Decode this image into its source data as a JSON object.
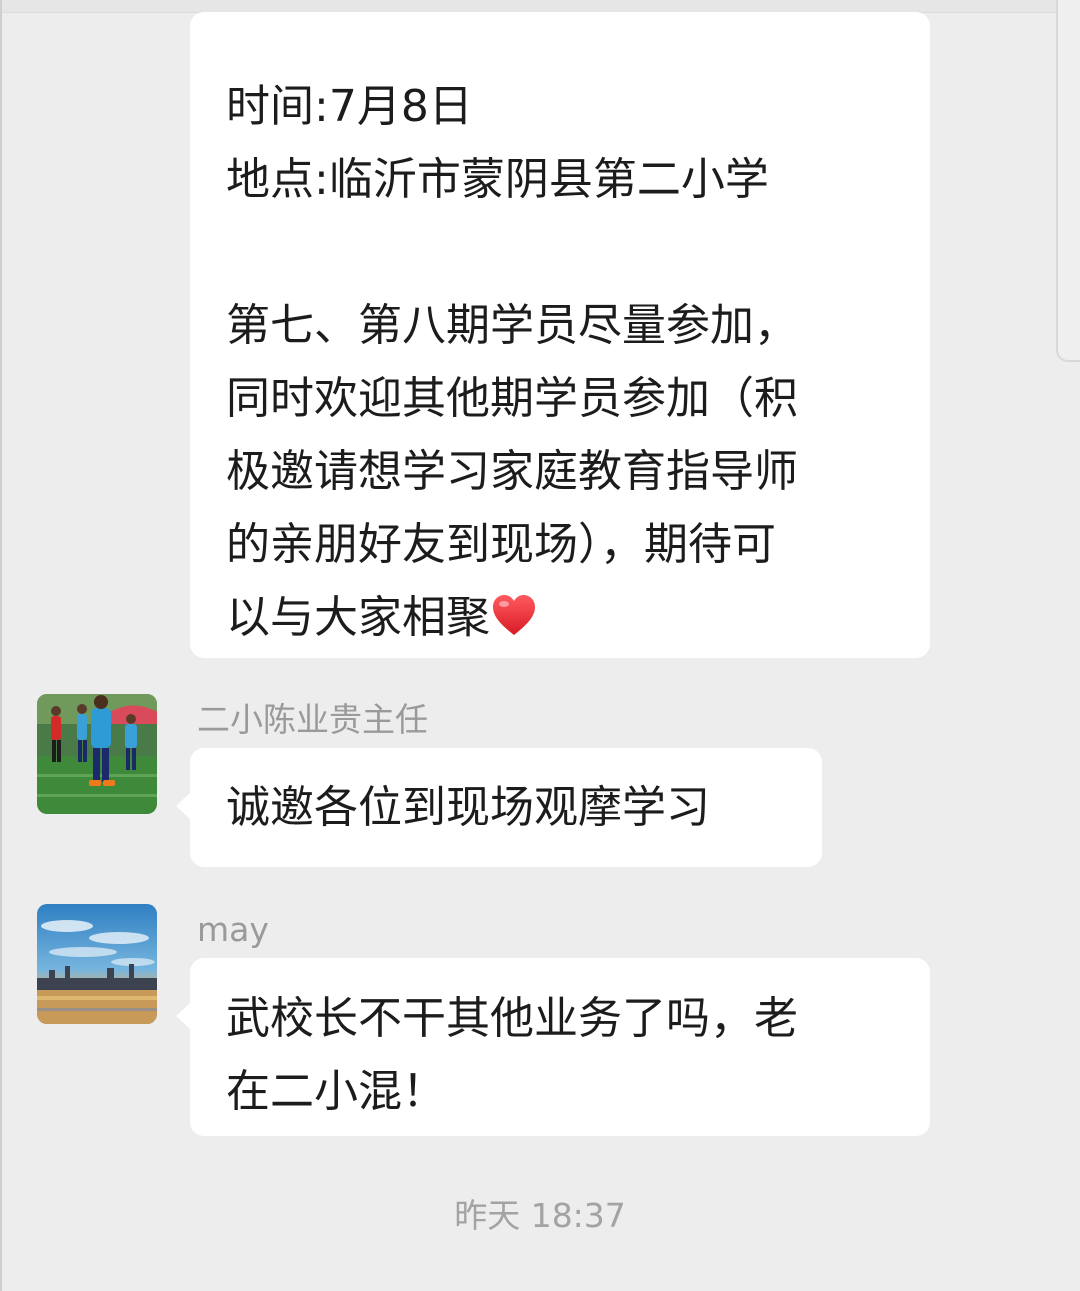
{
  "messages": [
    {
      "lines": [
        "时间:7月8日",
        "地点:临沂市蒙阴县第二小学",
        "",
        "第七、第八期学员尽量参加，",
        "同时欢迎其他期学员参加（积",
        "极邀请想学习家庭教育指导师",
        "的亲朋好友到现场），期待可",
        "以与大家相聚"
      ],
      "trailing_emoji": "red-heart-icon"
    },
    {
      "sender": "二小陈业贵主任",
      "avatar": "avatar-soccer-players",
      "lines": [
        "诚邀各位到现场观摩学习"
      ]
    },
    {
      "sender": "may",
      "avatar": "avatar-lake-sky",
      "lines": [
        "武校长不干其他业务了吗，老",
        "在二小混！"
      ]
    }
  ],
  "timestamp": "昨天 18:37",
  "colors": {
    "background": "#ededed",
    "bubble": "#ffffff",
    "text": "#1c1c1c",
    "meta_text": "#9a9a9a"
  }
}
